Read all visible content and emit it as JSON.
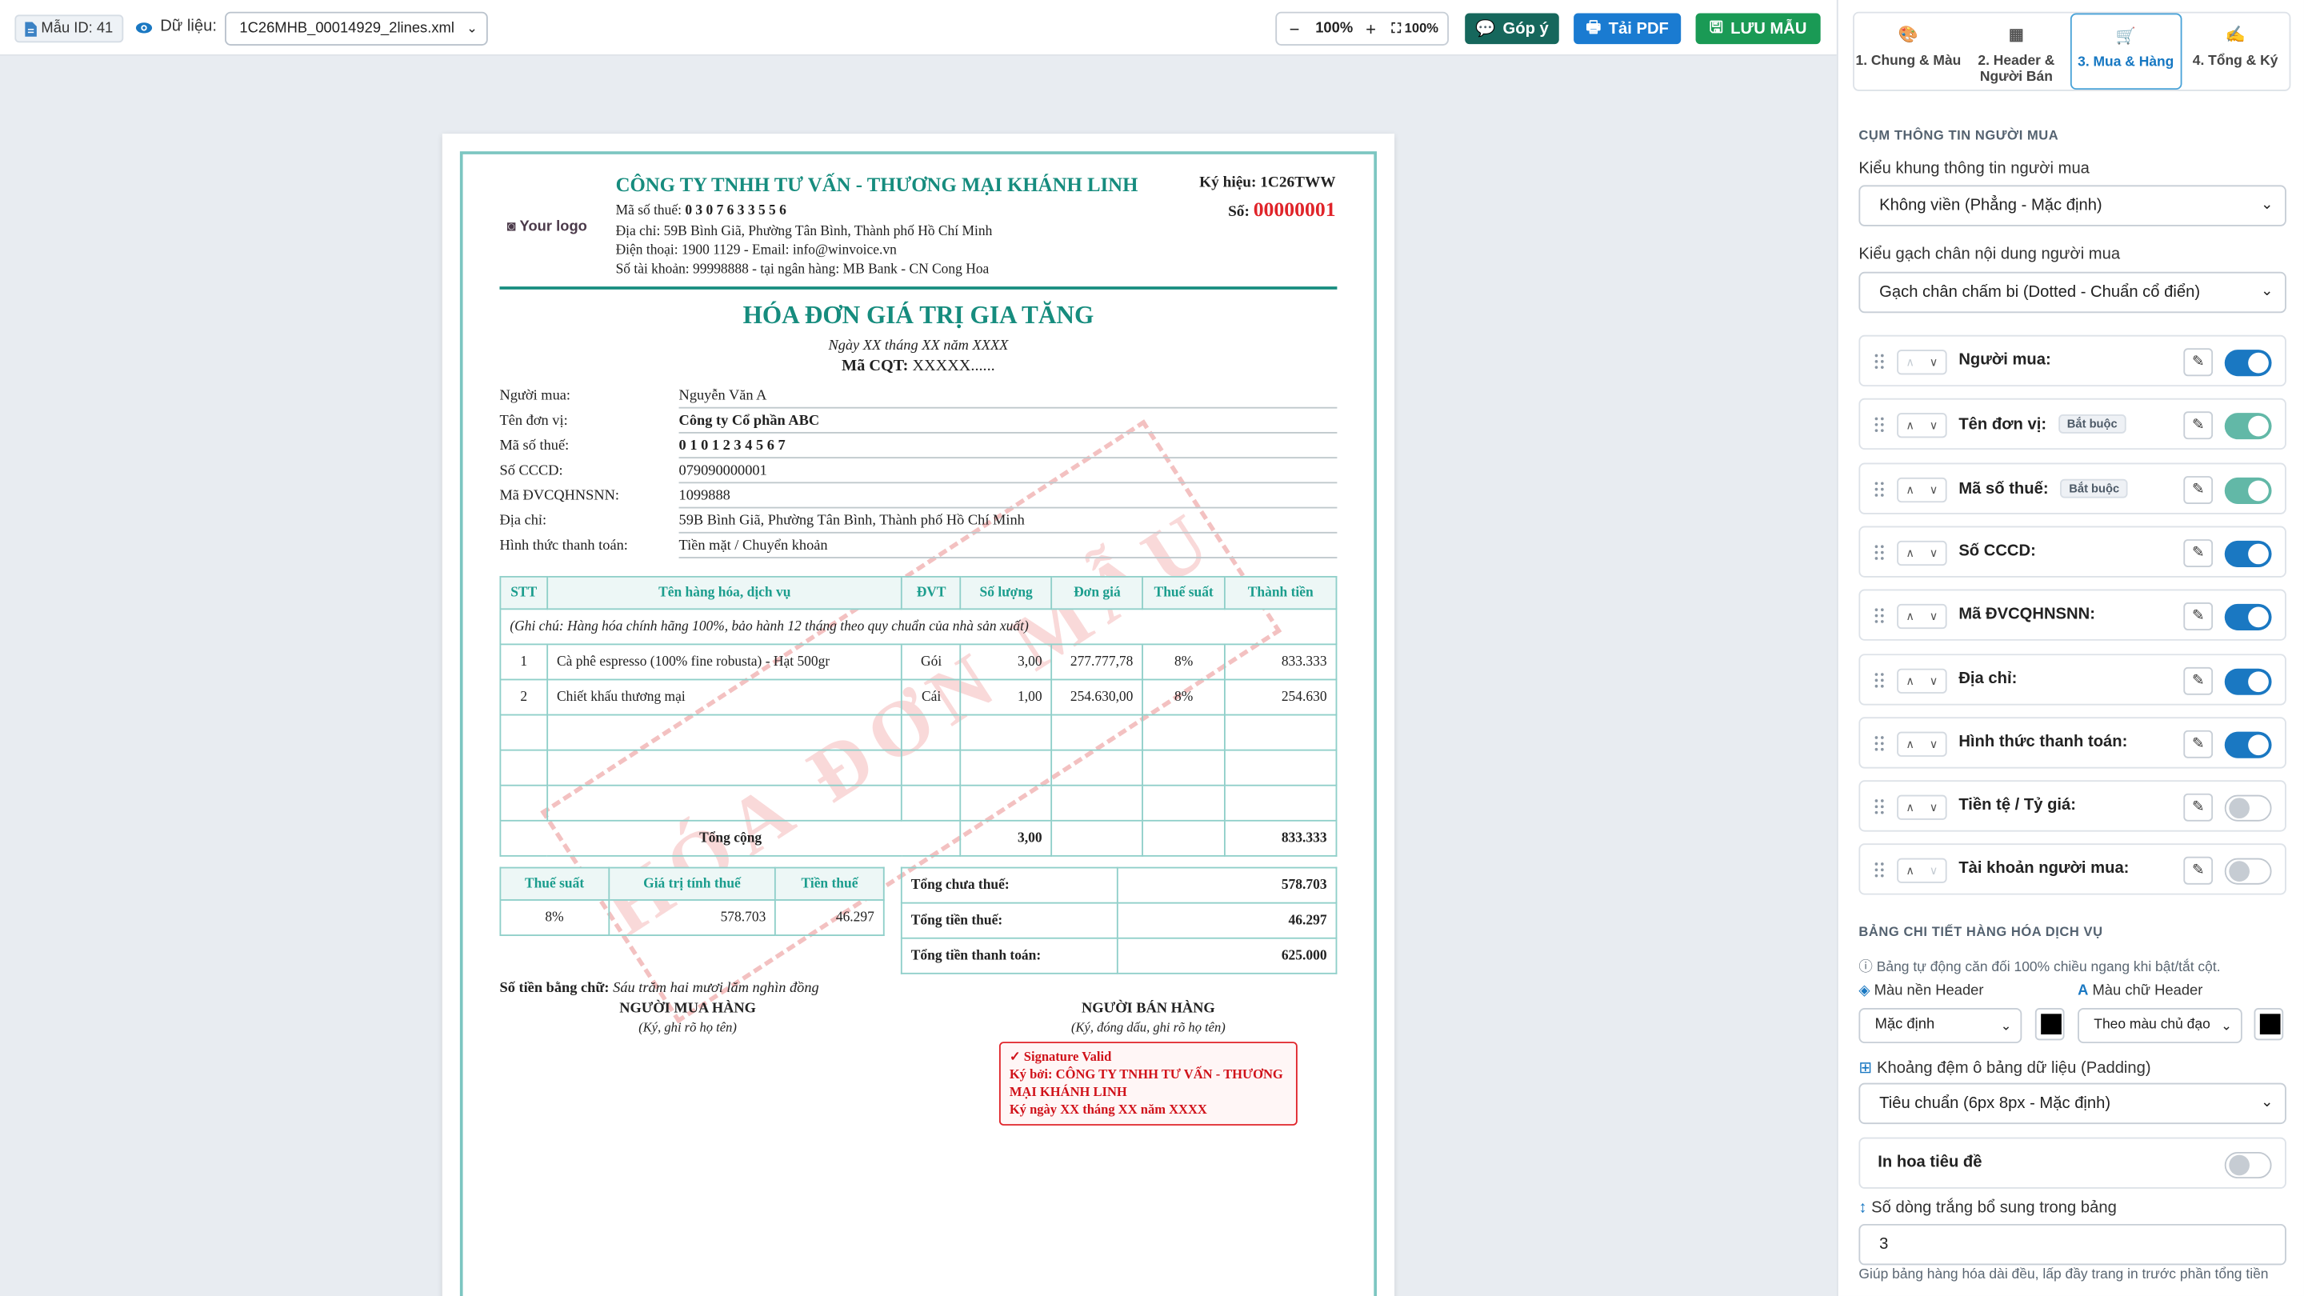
{
  "toolbar": {
    "template_id": "Mẫu ID: 41",
    "data_label": "Dữ liệu:",
    "data_file": "1C26MHB_00014929_2lines.xml",
    "zoom_minus": "−",
    "zoom_level": "100%",
    "zoom_plus": "+",
    "zoom_fit": "100%",
    "feedback": "Góp ý",
    "download_pdf": "Tải PDF",
    "save": "LƯU MẪU",
    "colors": {
      "feedback": "#16675c",
      "pdf": "#1a7bd1",
      "save": "#1a9a55"
    }
  },
  "invoice": {
    "logo": "Your logo",
    "seller_name": "CÔNG TY TNHH TƯ VẤN - THƯƠNG MẠI KHÁNH LINH",
    "seller_tax_label": "Mã số thuế:",
    "seller_tax": "0 3 0 7 6 3 3 5 5 6",
    "seller_address": "Địa chỉ: 59B Bình Giã, Phường Tân Bình, Thành phố Hồ Chí Minh",
    "seller_phone": "Điện thoại: 1900 1129 - Email: info@winvoice.vn",
    "seller_bank": "Số tài khoản: 99998888 - tại ngân hàng: MB Bank - CN Cong Hoa",
    "symbol_label": "Ký hiệu:",
    "symbol": "1C26TWW",
    "number_label": "Số:",
    "number": "00000001",
    "title": "HÓA ĐƠN GIÁ TRỊ GIA TĂNG",
    "date": "Ngày XX tháng XX năm XXXX",
    "cqt_label": "Mã CQT:",
    "cqt": "XXXXX......",
    "buyer_fields": [
      {
        "label": "Người mua:",
        "value": "Nguyễn Văn A"
      },
      {
        "label": "Tên đơn vị:",
        "value": "Công ty Cổ phần ABC"
      },
      {
        "label": "Mã số thuế:",
        "value": "0 1 0 1 2 3 4 5 6 7"
      },
      {
        "label": "Số CCCD:",
        "value": "079090000001"
      },
      {
        "label": "Mã ĐVCQHNSNN:",
        "value": "1099888"
      },
      {
        "label": "Địa chỉ:",
        "value": "59B Bình Giã, Phường Tân Bình, Thành phố Hồ Chí Minh"
      },
      {
        "label": "Hình thức thanh toán:",
        "value": "Tiền mặt / Chuyển khoản"
      }
    ],
    "table_headers": [
      "STT",
      "Tên hàng hóa, dịch vụ",
      "ĐVT",
      "Số lượng",
      "Đơn giá",
      "Thuế suất",
      "Thành tiền"
    ],
    "table_note": "(Ghi chú: Hàng hóa chính hãng 100%, bảo hành 12 tháng theo quy chuẩn của nhà sản xuất)",
    "items": [
      {
        "stt": "1",
        "name": "Cà phê espresso (100% fine robusta) - Hạt 500gr",
        "unit": "Gói",
        "qty": "3,00",
        "price": "277.777,78",
        "rate": "8%",
        "amount": "833.333"
      },
      {
        "stt": "2",
        "name": "Chiết khấu thương mại",
        "unit": "Cái",
        "qty": "1,00",
        "price": "254.630,00",
        "rate": "8%",
        "amount": "254.630"
      }
    ],
    "total_label": "Tổng cộng",
    "total_qty": "3,00",
    "total_amount": "833.333",
    "tax_headers": [
      "Thuế suất",
      "Giá trị tính thuế",
      "Tiền thuế"
    ],
    "tax_row": {
      "rate": "8%",
      "base": "578.703",
      "tax": "46.297"
    },
    "summary": [
      {
        "label": "Tổng chưa thuế:",
        "value": "578.703"
      },
      {
        "label": "Tổng tiền thuế:",
        "value": "46.297"
      },
      {
        "label": "Tổng tiền thanh toán:",
        "value": "625.000"
      }
    ],
    "words_label": "Số tiền bằng chữ:",
    "words": "Sáu trăm hai mươi lăm nghìn đồng",
    "buyer_sign_title": "NGƯỜI MUA HÀNG",
    "buyer_sign_note": "(Ký, ghi rõ họ tên)",
    "seller_sign_title": "NGƯỜI BÁN HÀNG",
    "seller_sign_note": "(Ký, đóng dấu, ghi rõ họ tên)",
    "sig_valid": "✓ Signature Valid",
    "sig_by": "Ký bởi: CÔNG TY TNHH TƯ VẤN - THƯƠNG MẠI KHÁNH LINH",
    "sig_date": "Ký ngày XX tháng XX năm XXXX",
    "watermark": "HÓA ĐƠN MẪU"
  },
  "panel": {
    "tabs": [
      {
        "label": "1. Chung & Màu",
        "icon": "palette-icon"
      },
      {
        "label": "2. Header & Người Bán",
        "icon": "building-icon"
      },
      {
        "label": "3. Mua & Hàng",
        "icon": "cart-icon"
      },
      {
        "label": "4. Tổng & Ký",
        "icon": "signature-icon"
      }
    ],
    "buyer_section_title": "CỤM THÔNG TIN NGƯỜI MUA",
    "frame_style_label": "Kiểu khung thông tin người mua",
    "frame_style_value": "Không viền (Phẳng - Mặc định)",
    "underline_label": "Kiểu gạch chân nội dung người mua",
    "underline_value": "Gạch chân chấm bi (Dotted - Chuẩn cổ điển)",
    "required_badge": "Bắt buộc",
    "fields": [
      {
        "label": "Người mua:",
        "state": "on",
        "required": false
      },
      {
        "label": "Tên đơn vị:",
        "state": "lock",
        "required": true
      },
      {
        "label": "Mã số thuế:",
        "state": "lock",
        "required": true
      },
      {
        "label": "Số CCCD:",
        "state": "on",
        "required": false
      },
      {
        "label": "Mã ĐVCQHNSNN:",
        "state": "on",
        "required": false
      },
      {
        "label": "Địa chỉ:",
        "state": "on",
        "required": false
      },
      {
        "label": "Hình thức thanh toán:",
        "state": "on",
        "required": false
      },
      {
        "label": "Tiền tệ / Tỷ giá:",
        "state": "off",
        "required": false
      },
      {
        "label": "Tài khoản người mua:",
        "state": "off",
        "required": false
      }
    ],
    "table_section_title": "BẢNG CHI TIẾT HÀNG HÓA DỊCH VỤ",
    "table_note": "Bảng tự động căn đối 100% chiều ngang khi bật/tắt cột.",
    "header_bg_label": "Màu nền Header",
    "header_bg_value": "Mặc định",
    "header_text_label": "Màu chữ Header",
    "header_text_value": "Theo màu chủ đạo",
    "padding_label": "Khoảng đệm ô bảng dữ liệu (Padding)",
    "padding_value": "Tiêu chuẩn (6px 8px - Mặc định)",
    "uppercase_label": "In hoa tiêu đề",
    "blank_rows_label": "Số dòng trắng bổ sung trong bảng",
    "blank_rows_value": "3",
    "blank_rows_note": "Giúp bảng hàng hóa dài đều, lấp đầy trang in trước phần tổng tiền"
  }
}
